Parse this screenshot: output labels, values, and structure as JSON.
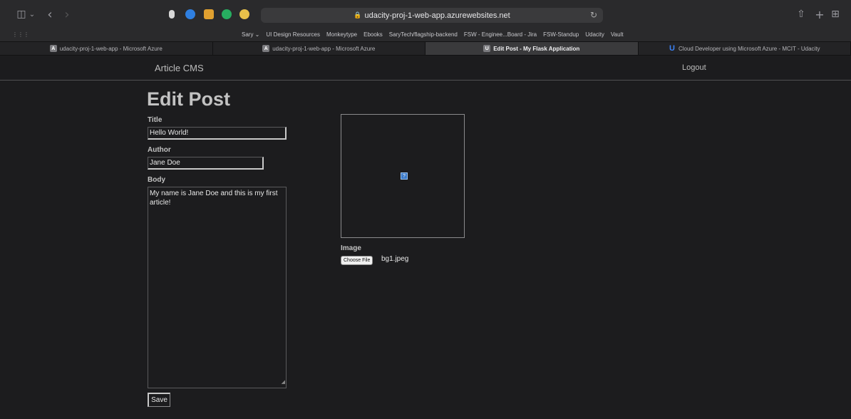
{
  "browser": {
    "address": "udacity-proj-1-web-app.azurewebsites.net",
    "favorites": [
      "Sary ⌄",
      "UI Design Resources",
      "Monkeytype",
      "Ebooks",
      "SaryTech/flagship-backend",
      "FSW - Enginee...Board - Jira",
      "FSW-Standup",
      "Udacity",
      "Vault"
    ],
    "tabs": [
      {
        "label": "udacity-proj-1-web-app - Microsoft Azure",
        "favicon": "A"
      },
      {
        "label": "udacity-proj-1-web-app - Microsoft Azure",
        "favicon": "A"
      },
      {
        "label": "Edit Post - My Flask Application",
        "favicon": "U"
      },
      {
        "label": "Cloud Developer using Microsoft Azure - MCIT - Udacity",
        "favicon": "U"
      }
    ],
    "icons": {
      "sidebar": "◫",
      "chevron": "⌄",
      "back": "‹",
      "forward": "›",
      "share": "⇧",
      "new_tab": "+",
      "tabs_overview": "⊞",
      "lock": "🔒",
      "reload": "↻",
      "grid": "⋮⋮⋮",
      "broken_image": "?",
      "resize_grip": "◢"
    }
  },
  "app": {
    "brand": "Article CMS",
    "logout": "Logout",
    "heading": "Edit Post",
    "title_label": "Title",
    "title_value": "Hello World!",
    "author_label": "Author",
    "author_value": "Jane Doe",
    "body_label": "Body",
    "body_value": "My name is Jane Doe and this is my first article!",
    "image_label": "Image",
    "choose_file": "Choose File",
    "file_name": "bg1.jpeg",
    "save": "Save"
  }
}
